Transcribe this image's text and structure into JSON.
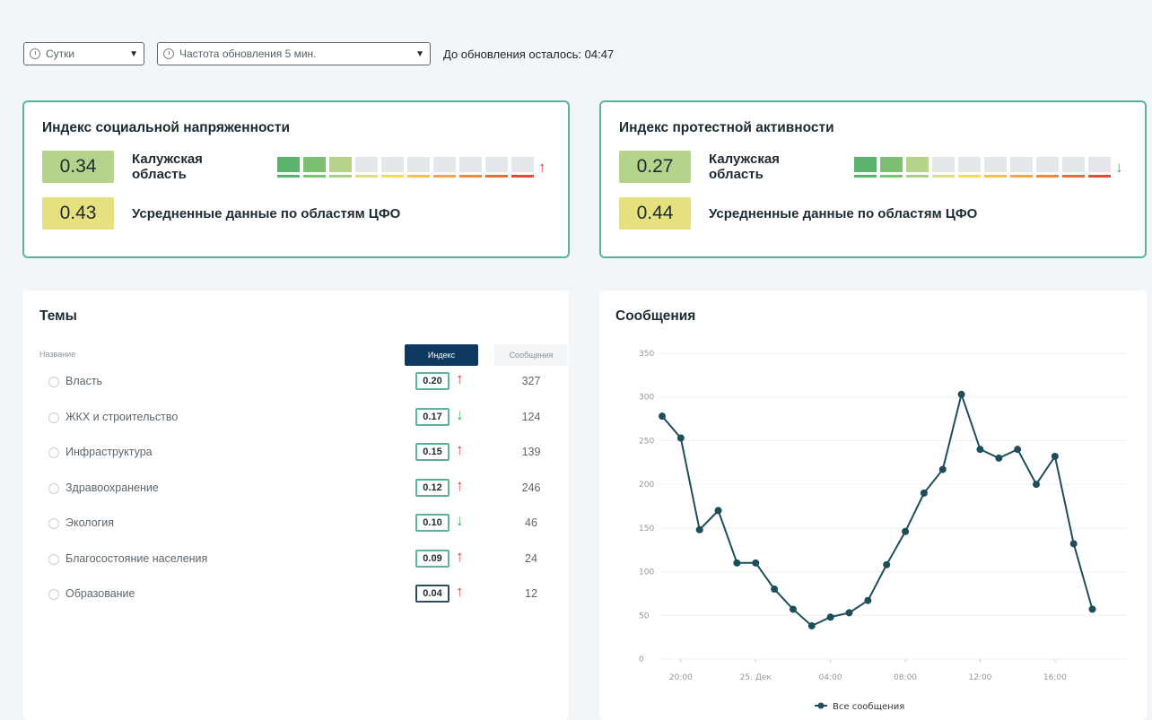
{
  "toolbar": {
    "period_label": "Сутки",
    "refresh_label": "Частота обновления 5 мин.",
    "countdown_text": "До обновления осталось: 04:47"
  },
  "social_tension": {
    "title": "Индекс социальной напряженности",
    "region_value": "0.34",
    "region_name": "Калужская область",
    "filled_segments": 3,
    "trend_arrow": "↑",
    "average_value": "0.43",
    "average_label": "Усредненные данные по областям ЦФО"
  },
  "protest_activity": {
    "title": "Индекс протестной активности",
    "region_value": "0.27",
    "region_name": "Калужская область",
    "filled_segments": 3,
    "trend_arrow": "↓",
    "average_value": "0.44",
    "average_label": "Усредненные данные по областям ЦФО"
  },
  "scale_colors": {
    "blocks": [
      "#5ab46e",
      "#7cc173",
      "#b5d48a",
      "#e4e7eb",
      "#e4e7eb",
      "#e4e7eb",
      "#e4e7eb",
      "#e4e7eb",
      "#e4e7eb",
      "#e4e7eb"
    ],
    "lines": [
      "#5ab46e",
      "#7cc173",
      "#a8d08c",
      "#d9e07a",
      "#f2e04a",
      "#f5c542",
      "#f2a541",
      "#ef8a3c",
      "#ea6b3b",
      "#e04b3b"
    ]
  },
  "topics": {
    "title": "Темы",
    "col_name": "Название",
    "col_index": "Индекс",
    "col_messages": "Сообщения",
    "rows": [
      {
        "name": "Власть",
        "index": "0.20",
        "trend": "↑",
        "dir": "up",
        "messages": "327"
      },
      {
        "name": "ЖКХ и строительство",
        "index": "0.17",
        "trend": "↓",
        "dir": "down",
        "messages": "124"
      },
      {
        "name": "Инфраструктура",
        "index": "0.15",
        "trend": "↑",
        "dir": "up",
        "messages": "139"
      },
      {
        "name": "Здравоохранение",
        "index": "0.12",
        "trend": "↑",
        "dir": "up",
        "messages": "246"
      },
      {
        "name": "Экология",
        "index": "0.10",
        "trend": "↓",
        "dir": "down",
        "messages": "46"
      },
      {
        "name": "Благосостояние населения",
        "index": "0.09",
        "trend": "↑",
        "dir": "up",
        "messages": "24"
      },
      {
        "name": "Образование",
        "index": "0.04",
        "trend": "↑",
        "dir": "up",
        "messages": "12"
      }
    ]
  },
  "messages": {
    "title": "Сообщения"
  },
  "chart_data": {
    "type": "line",
    "ylim": [
      0,
      350
    ],
    "yticks": [
      0,
      50,
      100,
      150,
      200,
      250,
      300,
      350
    ],
    "xticks": [
      "20:00",
      "25. Дек",
      "04:00",
      "08:00",
      "12:00",
      "16:00"
    ],
    "series": [
      {
        "name": "Все сообщения",
        "color": "#1d4e5a",
        "values": [
          278,
          253,
          148,
          170,
          110,
          110,
          80,
          57,
          38,
          48,
          53,
          67,
          108,
          146,
          190,
          217,
          303,
          240,
          230,
          240,
          200,
          232,
          132,
          57
        ]
      }
    ]
  }
}
